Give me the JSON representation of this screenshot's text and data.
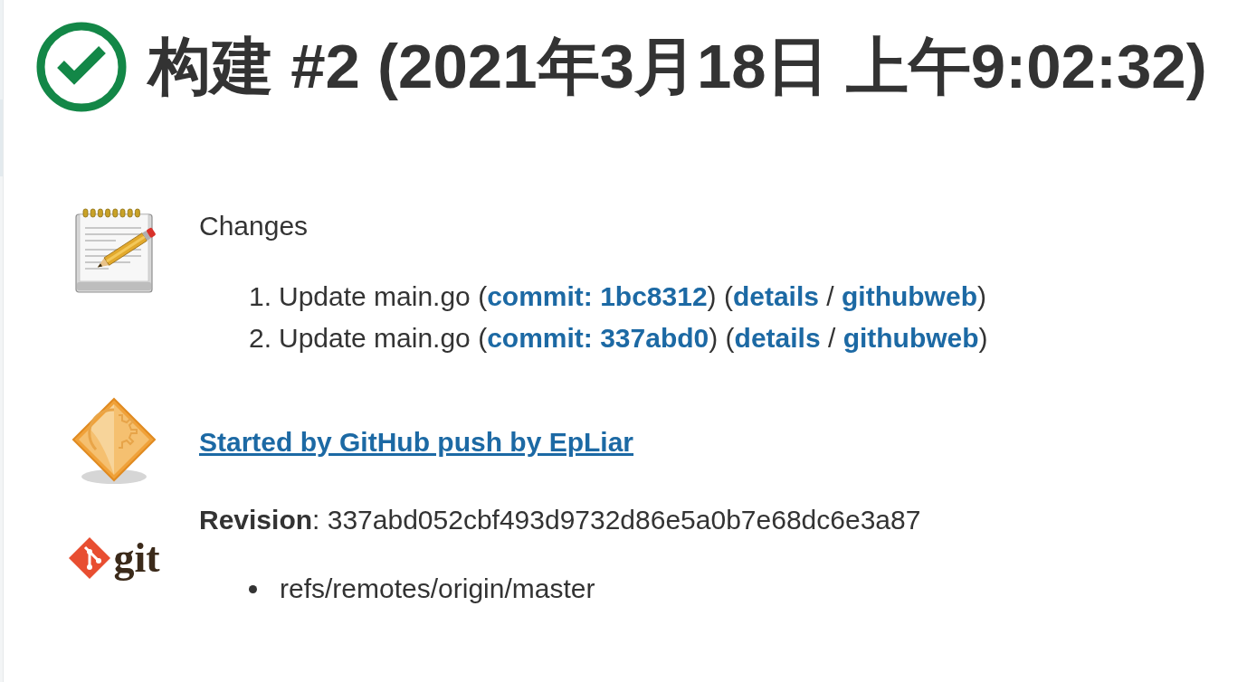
{
  "header": {
    "succeeded": true,
    "title": "构建 #2 (2021年3月18日 上午9:02:32)"
  },
  "changes": {
    "heading": "Changes",
    "items": [
      {
        "number": "1.",
        "parts": [
          {
            "kind": "text",
            "text": "Update main.go ("
          },
          {
            "kind": "link",
            "text": "commit: 1bc8312"
          },
          {
            "kind": "text",
            "text": ") ("
          },
          {
            "kind": "link",
            "text": "details"
          },
          {
            "kind": "text",
            "text": " / "
          },
          {
            "kind": "link",
            "text": "githubweb"
          },
          {
            "kind": "text",
            "text": ")"
          }
        ]
      },
      {
        "number": "2.",
        "parts": [
          {
            "kind": "text",
            "text": "Update main.go ("
          },
          {
            "kind": "link",
            "text": "commit: 337abd0"
          },
          {
            "kind": "text",
            "text": ") ("
          },
          {
            "kind": "link",
            "text": "details"
          },
          {
            "kind": "text",
            "text": " / "
          },
          {
            "kind": "link",
            "text": "githubweb"
          },
          {
            "kind": "text",
            "text": ")"
          }
        ]
      }
    ]
  },
  "cause": {
    "link": "Started by GitHub push by EpLiar"
  },
  "revision": {
    "logo_text": "git",
    "text": "**Revision**: 337abd052cbf493d9732d86e5a0b7e68dc6e3a87",
    "branches": [
      "refs/remotes/origin/master"
    ]
  }
}
